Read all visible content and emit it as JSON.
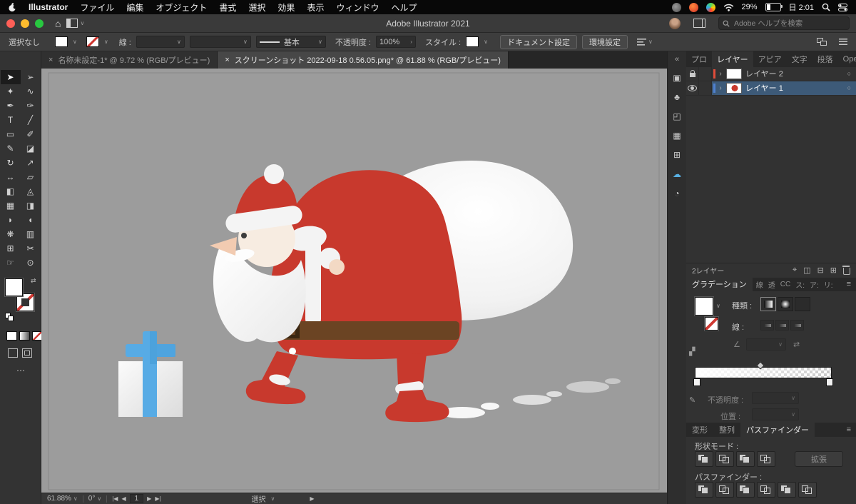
{
  "glyphs": {
    "caret": "∨",
    "close": "×",
    "collapse": "«",
    "more": "⋯",
    "disclosure": "›",
    "target": "○",
    "menu": "≡",
    "swap": "⇄",
    "angle": "∠",
    "nav_first": "|◀",
    "nav_prev": "◀",
    "nav_next": "▶",
    "nav_last": "▶|",
    "play": "▶"
  },
  "menu_bar": {
    "app_name": "Illustrator",
    "menus": [
      "ファイル",
      "編集",
      "オブジェクト",
      "書式",
      "選択",
      "効果",
      "表示",
      "ウィンドウ",
      "ヘルプ"
    ],
    "battery_percent": "29%",
    "clock": "日 2:01"
  },
  "title_bar": {
    "title": "Adobe Illustrator 2021",
    "search_placeholder": "Adobe ヘルプを検索"
  },
  "control_bar": {
    "selection_status": "選択なし",
    "stroke_label": "線 :",
    "brush_value": "基本",
    "opacity_label": "不透明度 :",
    "opacity_value": "100%",
    "style_label": "スタイル :",
    "document_setup_button": "ドキュメント設定",
    "preferences_button": "環境設定"
  },
  "document_tabs": {
    "tab1": "名称未設定-1* @ 9.72 % (RGB/プレビュー)",
    "tab2": "スクリーンショット 2022-09-18 0.56.05.png* @ 61.88 % (RGB/プレビュー)"
  },
  "toolbar": {
    "tools": [
      {
        "name": "selection-tool",
        "glyph": "➤"
      },
      {
        "name": "direct-selection-tool",
        "glyph": "➢"
      },
      {
        "name": "magic-wand-tool",
        "glyph": "✦"
      },
      {
        "name": "lasso-tool",
        "glyph": "∿"
      },
      {
        "name": "pen-tool",
        "glyph": "✒"
      },
      {
        "name": "curvature-tool",
        "glyph": "✑"
      },
      {
        "name": "type-tool",
        "glyph": "T"
      },
      {
        "name": "line-segment-tool",
        "glyph": "╱"
      },
      {
        "name": "rectangle-tool",
        "glyph": "▭"
      },
      {
        "name": "paintbrush-tool",
        "glyph": "✐"
      },
      {
        "name": "shaper-tool",
        "glyph": "✎"
      },
      {
        "name": "eraser-tool",
        "glyph": "◪"
      },
      {
        "name": "rotate-tool",
        "glyph": "↻"
      },
      {
        "name": "scale-tool",
        "glyph": "↗"
      },
      {
        "name": "width-tool",
        "glyph": "↔"
      },
      {
        "name": "free-transform-tool",
        "glyph": "▱"
      },
      {
        "name": "shape-builder-tool",
        "glyph": "◧"
      },
      {
        "name": "perspective-grid-tool",
        "glyph": "◬"
      },
      {
        "name": "mesh-tool",
        "glyph": "▦"
      },
      {
        "name": "gradient-tool",
        "glyph": "◨"
      },
      {
        "name": "eyedropper-tool",
        "glyph": "◗"
      },
      {
        "name": "blend-tool",
        "glyph": "◖"
      },
      {
        "name": "symbol-sprayer-tool",
        "glyph": "❋"
      },
      {
        "name": "column-graph-tool",
        "glyph": "▥"
      },
      {
        "name": "artboard-tool",
        "glyph": "⊞"
      },
      {
        "name": "slice-tool",
        "glyph": "✂"
      },
      {
        "name": "hand-tool",
        "glyph": "☞"
      },
      {
        "name": "zoom-tool",
        "glyph": "⊙"
      }
    ]
  },
  "strip_icons": [
    {
      "name": "shapes-panel-icon",
      "glyph": "▣"
    },
    {
      "name": "clover-panel-icon",
      "glyph": "♣"
    },
    {
      "name": "artboard-panel-icon",
      "glyph": "◰"
    },
    {
      "name": "export-panel-icon",
      "glyph": "▦"
    },
    {
      "name": "transform-panel-icon",
      "glyph": "⊞"
    },
    {
      "name": "cc-libraries-icon",
      "glyph": "☁"
    },
    {
      "name": "color-guide-icon",
      "glyph": "◔"
    }
  ],
  "canvas": {
    "background": "#9c9c9c",
    "artwork_colors": {
      "santa_red": "#c8392d",
      "fur_white": "#f4f4f4",
      "skin": "#f7ece1",
      "belt_brown": "#6b4423",
      "buckle_dark": "#3c2813",
      "ribbon_blue": "#57abe5",
      "sack_white": "#f6f6f6"
    }
  },
  "status_bar": {
    "zoom": "61.88%",
    "rotation": "0°",
    "artboard_number": "1",
    "tool_label": "選択"
  },
  "panels": {
    "tab_row": {
      "t1": "プロ",
      "t2": "レイヤー",
      "t3": "アピア",
      "t4": "文字",
      "t5": "段落",
      "t6": "Open"
    },
    "layers": {
      "rows": [
        {
          "name": "レイヤー 2",
          "color": "#e04c3a"
        },
        {
          "name": "レイヤー 1",
          "color": "#4f81d0"
        }
      ],
      "count_label": "2レイヤー",
      "selection_highlight": "#3d5a78"
    },
    "gradient": {
      "title": "グラデーション",
      "side_tabs": [
        "線",
        "透",
        "CC",
        "ス:",
        "ア:",
        "リ:"
      ],
      "type_label": "種類 :",
      "stroke_label": "線 :",
      "opacity_label": "不透明度 :",
      "location_label": "位置 :"
    },
    "pathfinder": {
      "tab_transform": "変形",
      "tab_align": "整列",
      "tab_pathfinder": "パスファインダー",
      "shape_mode_label": "形状モード :",
      "expand_button": "拡張",
      "pathfinder_label": "パスファインダー :"
    }
  }
}
